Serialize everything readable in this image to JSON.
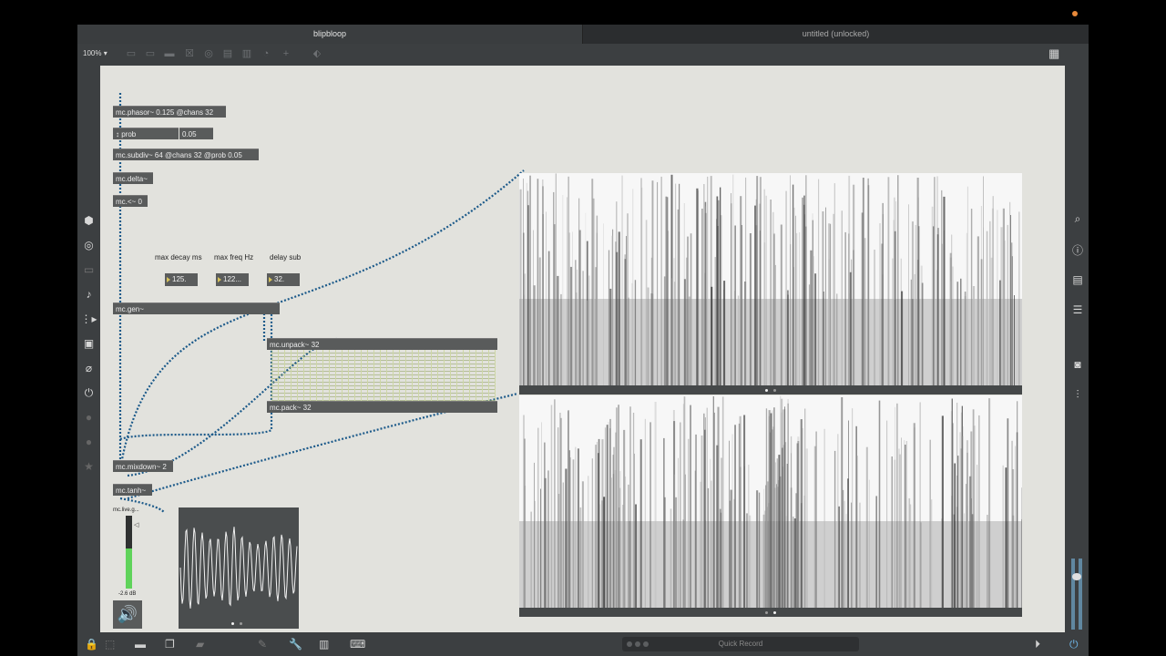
{
  "window": {
    "tabs": [
      "blipbloop",
      "untitled (unlocked)"
    ],
    "zoom": "100%"
  },
  "patch": {
    "objects": {
      "phasor": "mc.phasor~ 0.125 @chans 32",
      "prob_attr": "prob",
      "prob_value": "0.05",
      "subdiv": "mc.subdiv~ 64 @chans 32 @prob 0.05",
      "delta": "mc.delta~",
      "lessthan": "mc.<~ 0",
      "gen": "mc.gen~",
      "unpack": "mc.unpack~ 32",
      "pack": "mc.pack~ 32",
      "mixdown": "mc.mixdown~ 2",
      "tanh": "mc.tanh~"
    },
    "params": [
      {
        "label": "max decay ms",
        "value": "125."
      },
      {
        "label": "max freq Hz",
        "value": "122..."
      },
      {
        "label": "delay sub",
        "value": "32."
      }
    ],
    "gain": {
      "name": "mc.live.g...",
      "value": "-2.6 dB",
      "level": 0.55
    }
  },
  "footer": {
    "quick_record": "Quick Record"
  },
  "icons": {
    "left_sidebar": [
      "cube-icon",
      "target-icon",
      "panel-icon",
      "music-note-icon",
      "sequence-icon",
      "image-icon",
      "paperclip-icon",
      "plugin-icon",
      "circle-icon",
      "circle-icon",
      "star-icon"
    ],
    "right_sidebar": [
      "search-icon",
      "info-icon",
      "book-icon",
      "list-icon",
      "camera-icon",
      "mixer-icon"
    ]
  },
  "colors": {
    "patchcord": "#1c5a8a",
    "accent": "#e8893a"
  }
}
